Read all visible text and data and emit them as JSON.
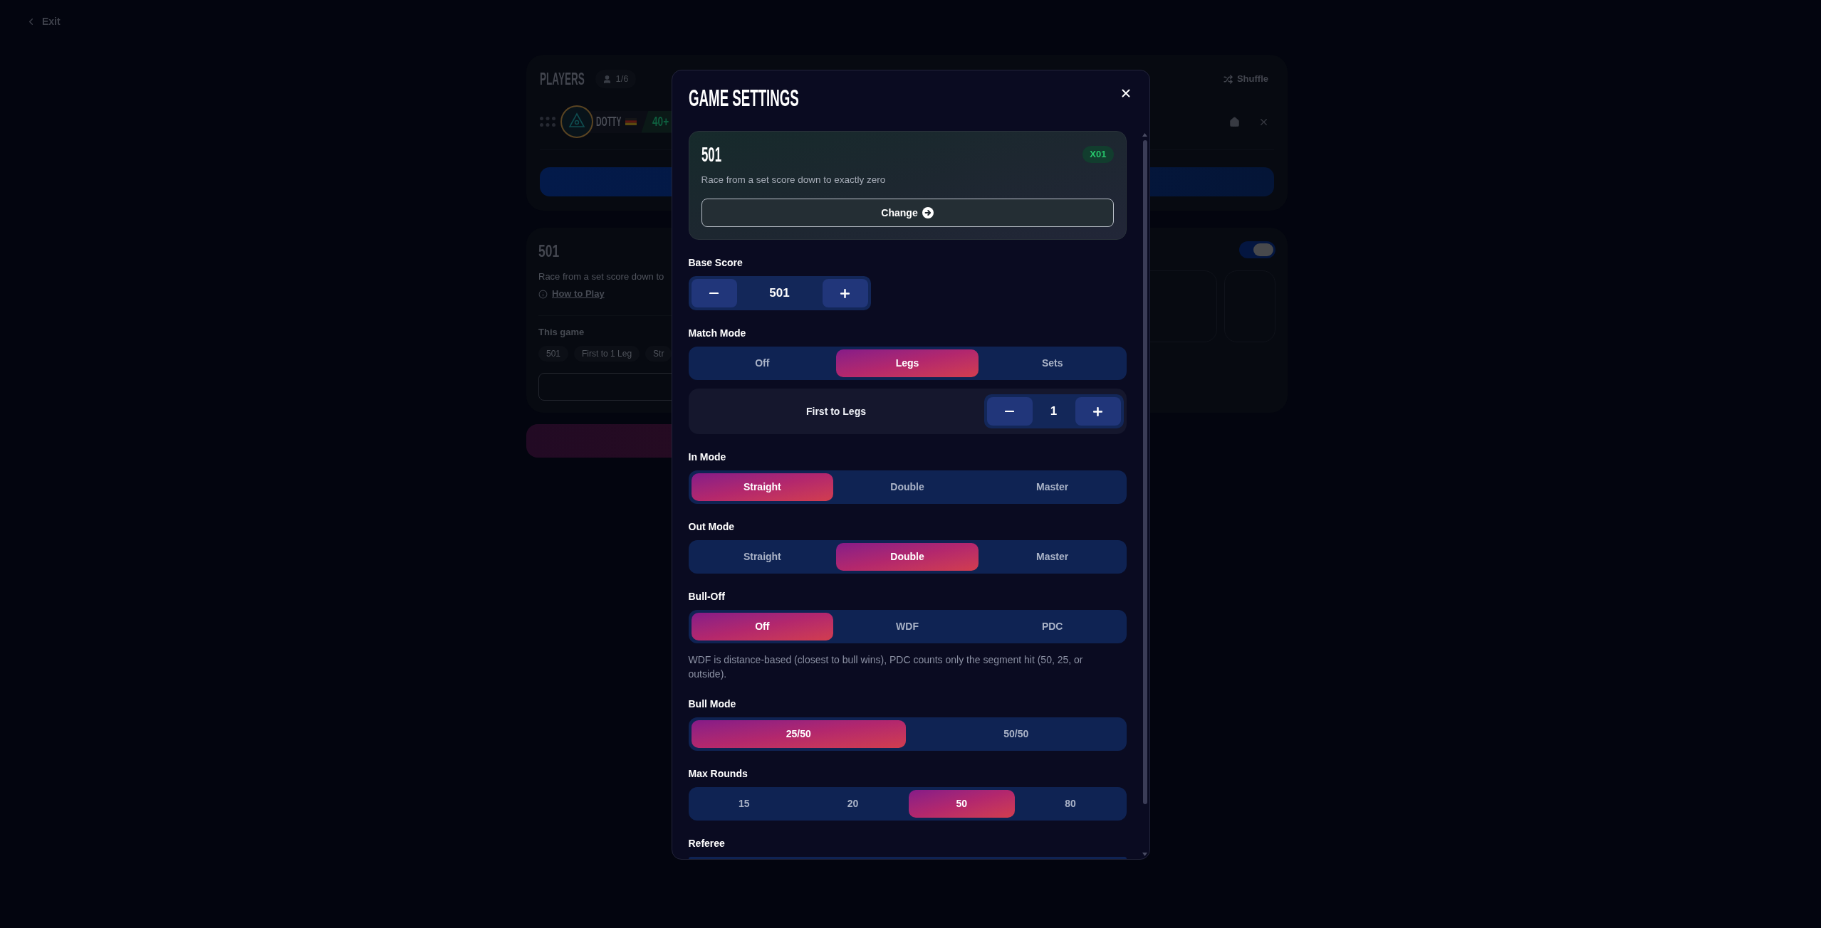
{
  "exit_link": {
    "label": "Exit"
  },
  "players_panel": {
    "title": "PLAYERS",
    "count": "1/6",
    "shuffle_label": "Shuffle",
    "players": [
      {
        "name": "DOTTY",
        "tag": "40+"
      }
    ]
  },
  "game_panel": {
    "title": "501",
    "description": "Race from a set score down to",
    "link": "How to Play",
    "section_label": "This game",
    "chips": [
      "501",
      "First to 1 Leg",
      "Str"
    ],
    "toggle": {
      "on": true
    }
  },
  "modal": {
    "title": "GAME SETTINGS",
    "game_card": {
      "title": "501",
      "badge": "X01",
      "description": "Race from a set score down to exactly zero",
      "button": "Change"
    },
    "sections": [
      {
        "kind": "stepper",
        "label": "Base Score",
        "value": "501"
      },
      {
        "kind": "segmented",
        "label": "Match Mode",
        "options": [
          {
            "label": "Off",
            "selected": false
          },
          {
            "label": "Legs",
            "selected": true
          },
          {
            "label": "Sets",
            "selected": false
          }
        ],
        "target": {
          "label": "First to Legs",
          "value": "1"
        }
      },
      {
        "kind": "segmented",
        "label": "In Mode",
        "options": [
          {
            "label": "Straight",
            "selected": true
          },
          {
            "label": "Double",
            "selected": false
          },
          {
            "label": "Master",
            "selected": false
          }
        ]
      },
      {
        "kind": "segmented",
        "label": "Out Mode",
        "options": [
          {
            "label": "Straight",
            "selected": false
          },
          {
            "label": "Double",
            "selected": true
          },
          {
            "label": "Master",
            "selected": false
          }
        ]
      },
      {
        "kind": "segmented",
        "label": "Bull-Off",
        "options": [
          {
            "label": "Off",
            "selected": true
          },
          {
            "label": "WDF",
            "selected": false
          },
          {
            "label": "PDC",
            "selected": false
          }
        ],
        "hint": "WDF is distance-based (closest to bull wins), PDC counts only the segment hit (50, 25, or outside)."
      },
      {
        "kind": "segmented",
        "label": "Bull Mode",
        "options": [
          {
            "label": "25/50",
            "selected": true
          },
          {
            "label": "50/50",
            "selected": false
          }
        ]
      },
      {
        "kind": "segmented",
        "label": "Max Rounds",
        "options": [
          {
            "label": "15",
            "selected": false
          },
          {
            "label": "20",
            "selected": false
          },
          {
            "label": "50",
            "selected": true
          },
          {
            "label": "80",
            "selected": false
          }
        ]
      },
      {
        "kind": "segmented",
        "label": "Referee"
      }
    ]
  }
}
